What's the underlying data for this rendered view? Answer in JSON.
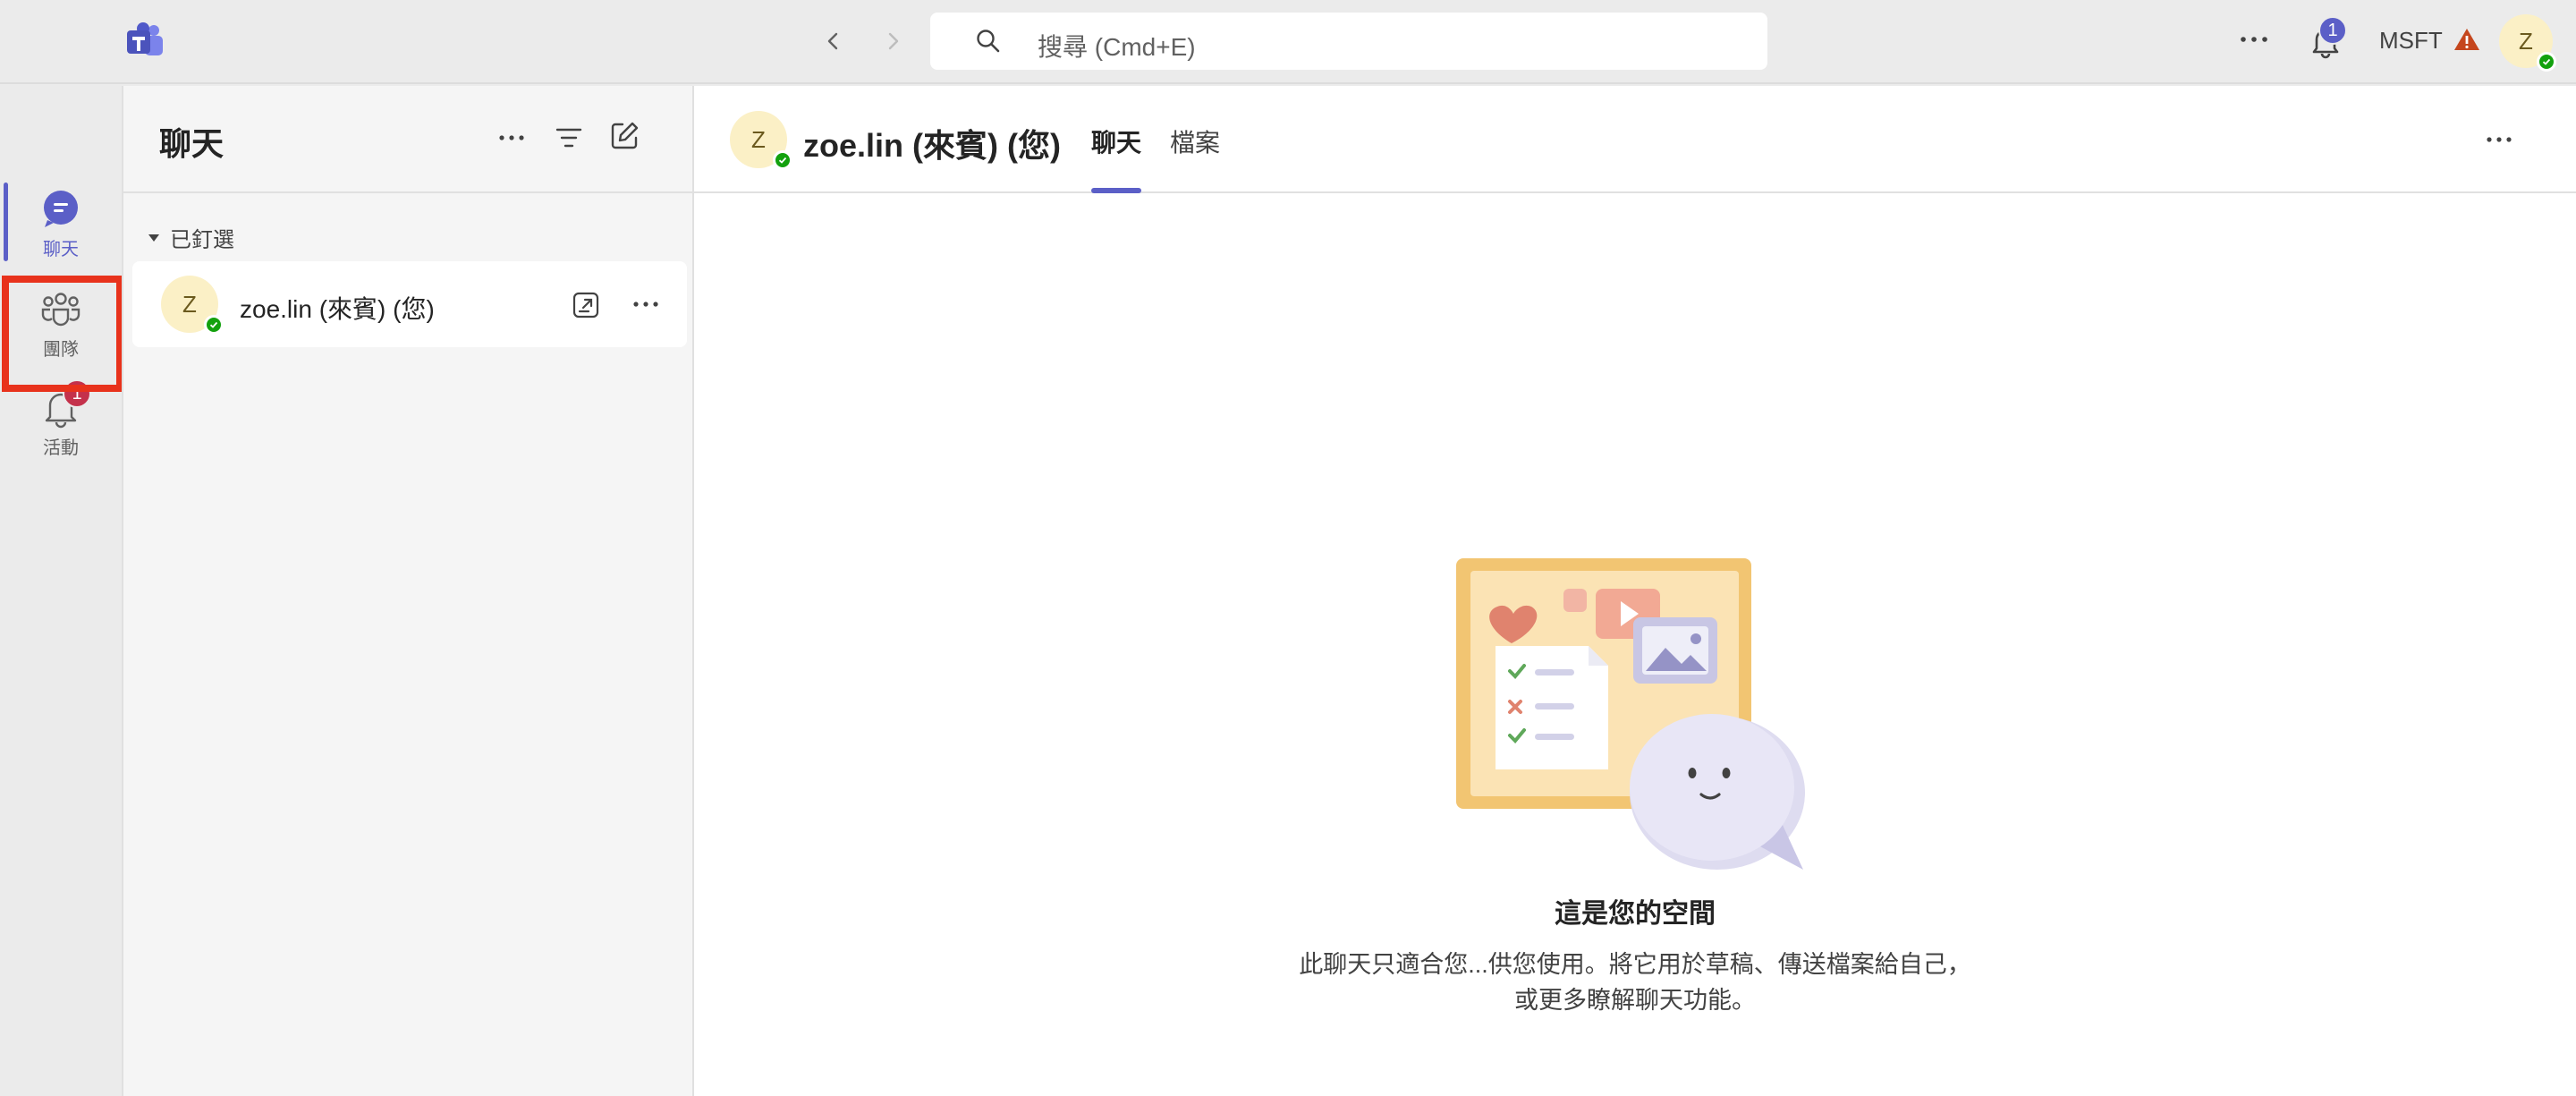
{
  "titlebar": {
    "search_placeholder": "搜尋 (Cmd+E)",
    "notification_count": "1",
    "org_name": "MSFT",
    "avatar_initial": "Z"
  },
  "rail": {
    "items": [
      {
        "label": "聊天",
        "icon": "chat-icon",
        "active": true
      },
      {
        "label": "團隊",
        "icon": "teams-icon",
        "active": false
      },
      {
        "label": "活動",
        "icon": "bell-icon",
        "active": false,
        "badge": "1"
      }
    ]
  },
  "chat_list": {
    "title": "聊天",
    "pinned_label": "已釘選",
    "items": [
      {
        "avatar_initial": "Z",
        "name": "zoe.lin (來賓) (您)"
      }
    ]
  },
  "main": {
    "avatar_initial": "Z",
    "title": "zoe.lin (來賓) (您)",
    "tabs": [
      {
        "label": "聊天",
        "active": true
      },
      {
        "label": "檔案",
        "active": false
      }
    ],
    "empty_title": "這是您的空間",
    "empty_desc_line1": "此聊天只適合您...供您使用。將它用於草稿、傳送檔案給自己，",
    "empty_desc_line2": "或更多瞭解聊天功能。"
  },
  "colors": {
    "accent": "#5b5fc7",
    "badge_red": "#c4314b",
    "highlight": "#e8321c",
    "presence_green": "#13a10e"
  }
}
